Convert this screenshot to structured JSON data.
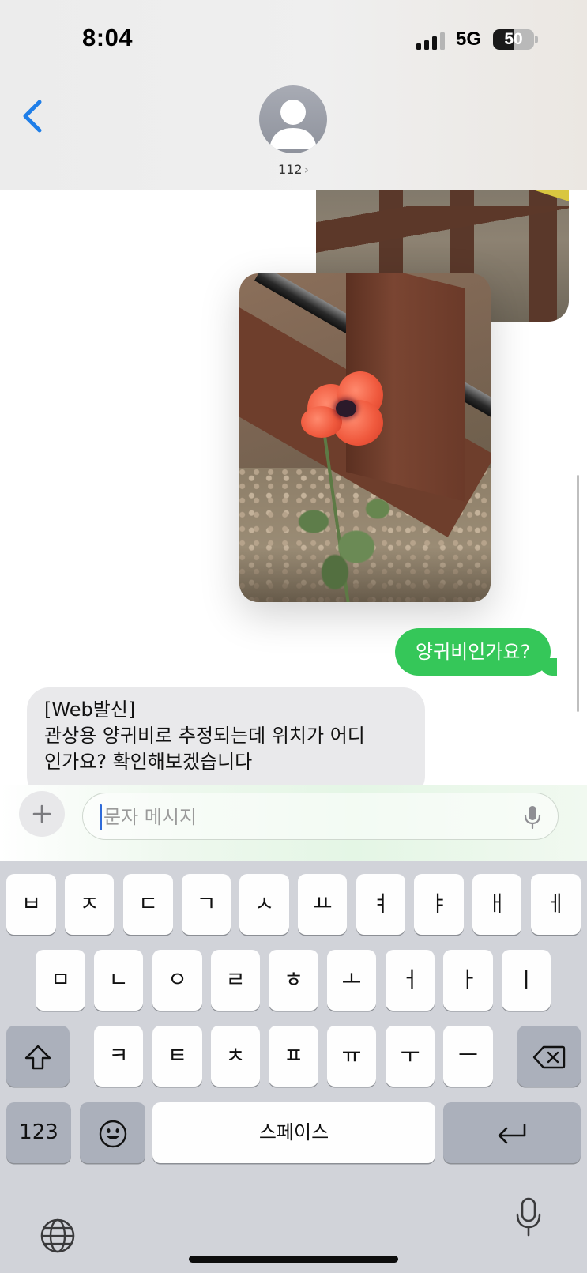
{
  "status_bar": {
    "time": "8:04",
    "network": "5G",
    "battery_level": "50",
    "battery_fraction": 0.5
  },
  "header": {
    "contact_name": "112",
    "chevron": "›",
    "back_icon": "chevron-left-icon",
    "avatar_icon": "person-icon"
  },
  "colors": {
    "sent_bubble": "#35c759",
    "received_bubble": "#e9e9eb",
    "accent_blue": "#1f7ee8",
    "keyboard_bg": "#d1d3d9"
  },
  "messages": {
    "sent_text": "양귀비인가요?",
    "received_lines": [
      "[Web발신]",
      "관상용 양귀비로 추정되는데 위치가 어디",
      "인가요? 확인해보겠습니다"
    ]
  },
  "composer": {
    "placeholder": "문자 메시지",
    "plus_icon": "plus-icon",
    "mic_icon": "microphone-icon"
  },
  "keyboard": {
    "row1": [
      "ㅂ",
      "ㅈ",
      "ㄷ",
      "ㄱ",
      "ㅅ",
      "ㅛ",
      "ㅕ",
      "ㅑ",
      "ㅐ",
      "ㅔ"
    ],
    "row2": [
      "ㅁ",
      "ㄴ",
      "ㅇ",
      "ㄹ",
      "ㅎ",
      "ㅗ",
      "ㅓ",
      "ㅏ",
      "ㅣ"
    ],
    "row3": [
      "ㅋ",
      "ㅌ",
      "ㅊ",
      "ㅍ",
      "ㅠ",
      "ㅜ",
      "ㅡ"
    ],
    "numbers_label": "123",
    "space_label": "스페이스",
    "shift_icon": "shift-icon",
    "delete_icon": "backspace-icon",
    "emoji_icon": "emoji-icon",
    "return_icon": "return-icon",
    "globe_icon": "globe-icon",
    "dictation_icon": "microphone-icon"
  }
}
